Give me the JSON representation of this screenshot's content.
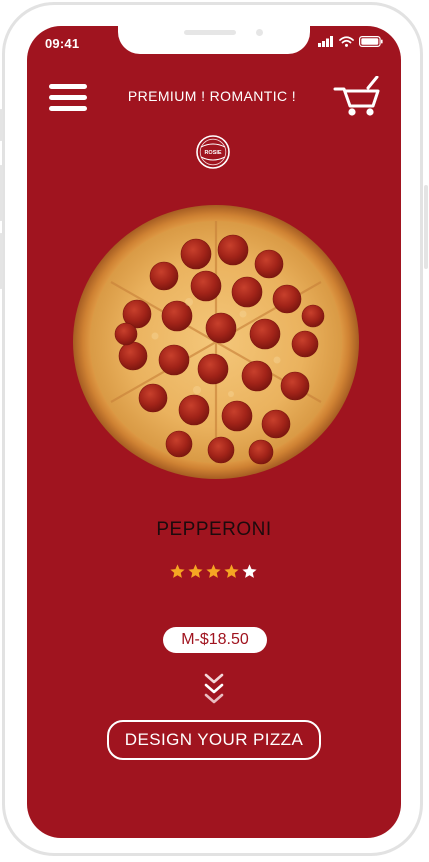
{
  "status_bar": {
    "time": "09:41",
    "icons": [
      "cellular-signal-icon",
      "wifi-icon",
      "battery-icon"
    ]
  },
  "header": {
    "menu_icon": "hamburger-menu-icon",
    "title": "PREMIUM ! ROMANTIC !",
    "cart_icon": "shopping-cart-icon"
  },
  "logo": {
    "text": "ROSIE"
  },
  "product": {
    "image": "pepperoni-pizza-image",
    "name": "PEPPERONI",
    "rating": 4,
    "rating_max": 5,
    "price_label": "M-$18.50"
  },
  "actions": {
    "scroll_icon": "double-chevron-down-icon",
    "design_button_label": "DESIGN YOUR PIZZA"
  },
  "colors": {
    "background": "#a0141f",
    "star_filled": "#f5a623",
    "star_empty": "#ffffff",
    "text_light": "#ffffff",
    "text_dark": "#1c0b0d"
  }
}
